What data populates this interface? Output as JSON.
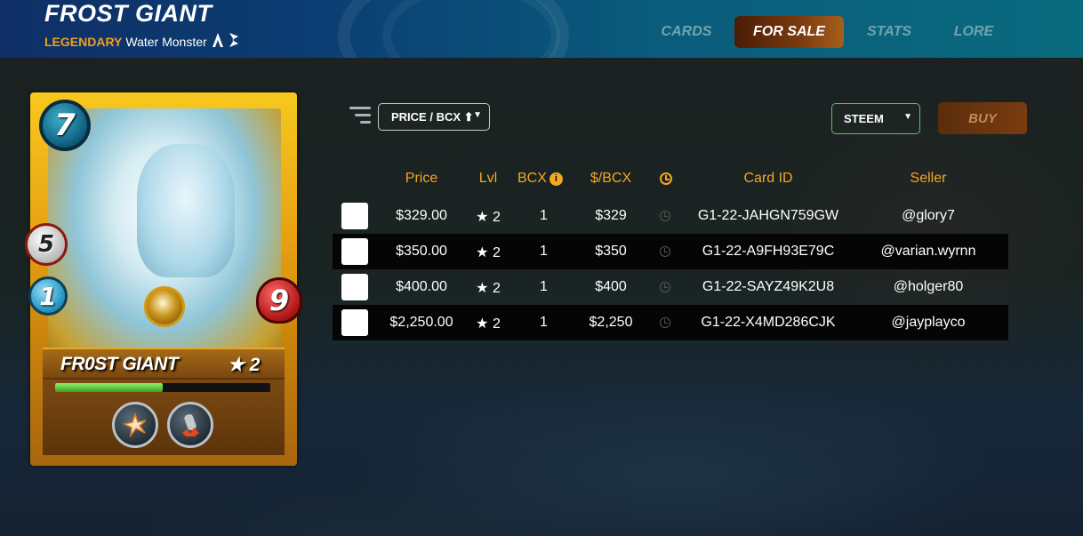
{
  "header": {
    "title": "FROST GIANT",
    "rarity": "LEGENDARY",
    "subtitle": "Water Monster",
    "tabs": [
      {
        "label": "CARDS",
        "active": false
      },
      {
        "label": "FOR SALE",
        "active": true
      },
      {
        "label": "STATS",
        "active": false
      },
      {
        "label": "LORE",
        "active": false
      }
    ]
  },
  "card": {
    "name": "FR0ST GIANT",
    "level": "★ 2",
    "mana": "7",
    "attack": "5",
    "speed": "1",
    "health": "9",
    "progress": 0.5,
    "abilities": [
      "shatter-icon",
      "reach-icon"
    ]
  },
  "controls": {
    "sort_label": "PRICE / BCX ⬆",
    "currency_label": "STEEM",
    "buy_label": "BUY",
    "accent": "#f5a623"
  },
  "table": {
    "headers": {
      "price": "Price",
      "lvl": "Lvl",
      "bcx": "BCX",
      "per_bcx": "$/BCX",
      "card_id": "Card ID",
      "seller": "Seller"
    },
    "rows": [
      {
        "price": "$329.00",
        "lvl": "★ 2",
        "bcx": "1",
        "per_bcx": "$329",
        "card_id": "G1-22-JAHGN759GW",
        "seller": "@glory7"
      },
      {
        "price": "$350.00",
        "lvl": "★ 2",
        "bcx": "1",
        "per_bcx": "$350",
        "card_id": "G1-22-A9FH93E79C",
        "seller": "@varian.wyrnn"
      },
      {
        "price": "$400.00",
        "lvl": "★ 2",
        "bcx": "1",
        "per_bcx": "$400",
        "card_id": "G1-22-SAYZ49K2U8",
        "seller": "@holger80"
      },
      {
        "price": "$2,250.00",
        "lvl": "★ 2",
        "bcx": "1",
        "per_bcx": "$2,250",
        "card_id": "G1-22-X4MD286CJK",
        "seller": "@jayplayco"
      }
    ]
  }
}
